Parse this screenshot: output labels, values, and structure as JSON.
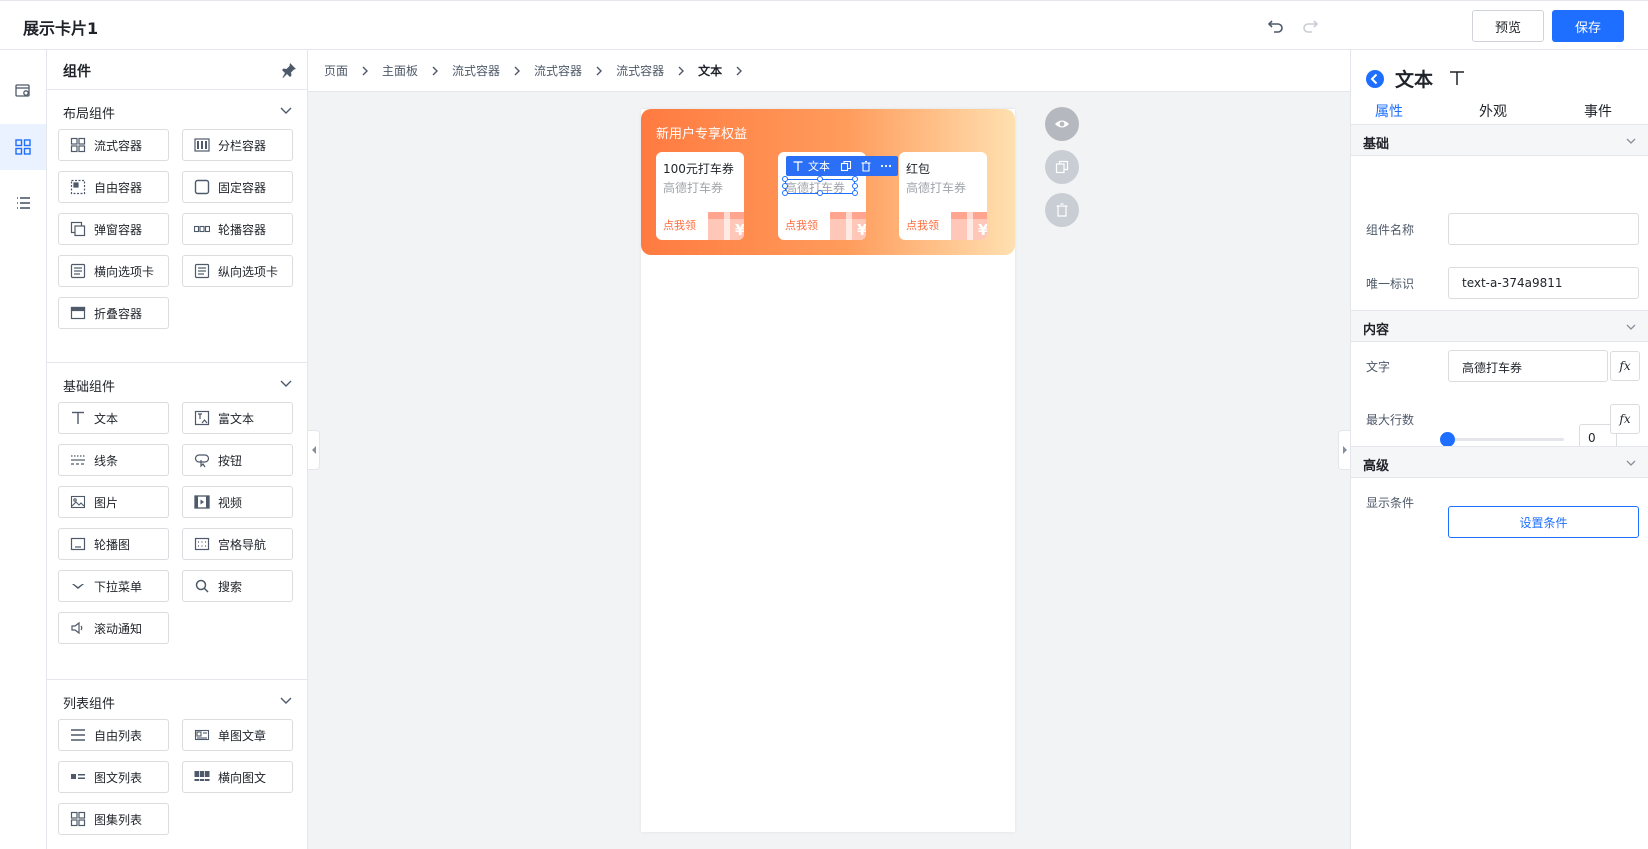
{
  "topbar": {
    "title": "展示卡片1",
    "undo_icon": "undo-icon",
    "redo_icon": "redo-icon",
    "preview_label": "预览",
    "save_label": "保存"
  },
  "rail": {
    "items": [
      {
        "icon": "page-settings-icon"
      },
      {
        "icon": "components-grid-icon",
        "active": true
      },
      {
        "icon": "outline-tree-icon"
      }
    ]
  },
  "panel": {
    "title": "组件",
    "groups": [
      {
        "title": "布局组件",
        "items": [
          {
            "label": "流式容器",
            "icon": "flow-container-icon"
          },
          {
            "label": "分栏容器",
            "icon": "columns-container-icon"
          },
          {
            "label": "自由容器",
            "icon": "free-container-icon"
          },
          {
            "label": "固定容器",
            "icon": "fixed-container-icon"
          },
          {
            "label": "弹窗容器",
            "icon": "popup-container-icon"
          },
          {
            "label": "轮播容器",
            "icon": "carousel-container-icon"
          },
          {
            "label": "横向选项卡",
            "icon": "horizontal-tabs-icon"
          },
          {
            "label": "纵向选项卡",
            "icon": "vertical-tabs-icon"
          },
          {
            "label": "折叠容器",
            "icon": "collapse-container-icon"
          }
        ]
      },
      {
        "title": "基础组件",
        "items": [
          {
            "label": "文本",
            "icon": "text-icon"
          },
          {
            "label": "富文本",
            "icon": "rich-text-icon"
          },
          {
            "label": "线条",
            "icon": "line-icon"
          },
          {
            "label": "按钮",
            "icon": "button-icon"
          },
          {
            "label": "图片",
            "icon": "image-icon"
          },
          {
            "label": "视频",
            "icon": "video-icon"
          },
          {
            "label": "轮播图",
            "icon": "carousel-icon"
          },
          {
            "label": "宫格导航",
            "icon": "grid-nav-icon"
          },
          {
            "label": "下拉菜单",
            "icon": "dropdown-icon"
          },
          {
            "label": "搜索",
            "icon": "search-icon"
          },
          {
            "label": "滚动通知",
            "icon": "notice-icon"
          }
        ]
      },
      {
        "title": "列表组件",
        "items": [
          {
            "label": "自由列表",
            "icon": "free-list-icon"
          },
          {
            "label": "单图文章",
            "icon": "single-image-article-icon"
          },
          {
            "label": "图文列表",
            "icon": "image-text-list-icon"
          },
          {
            "label": "横向图文",
            "icon": "horizontal-image-text-icon"
          },
          {
            "label": "图集列表",
            "icon": "gallery-list-icon"
          }
        ]
      }
    ]
  },
  "breadcrumb": [
    "页面",
    "主面板",
    "流式容器",
    "流式容器",
    "流式容器",
    "文本"
  ],
  "canvas": {
    "banner_title": "新用户专享权益",
    "coupons": [
      {
        "title": "100元打车券",
        "subtitle": "高德打车券",
        "action": "点我领"
      },
      {
        "title": "",
        "subtitle": "高德打车券",
        "action": "点我领"
      },
      {
        "title": "红包",
        "subtitle": "高德打车券",
        "action": "点我领"
      }
    ],
    "selection_toolbar_label": "文本",
    "colors": {
      "banner_start": "#ff7a40",
      "banner_end": "#ffe0b0",
      "coupon_action": "#ff6b3d",
      "selection": "#1e6fff"
    }
  },
  "props": {
    "title": "文本",
    "tabs": [
      "属性",
      "外观",
      "事件"
    ],
    "sections": {
      "basic": "基础",
      "content": "内容",
      "advanced": "高级"
    },
    "fields": {
      "name_label": "组件名称",
      "name_value": "",
      "id_label": "唯一标识",
      "id_value": "text-a-374a9811",
      "text_label": "文字",
      "text_value": "高德打车券",
      "max_lines_label": "最大行数",
      "max_lines_value": "0",
      "fx": "fx",
      "condition_label": "显示条件",
      "condition_button": "设置条件"
    },
    "colors": {
      "accent": "#1e6fff"
    }
  }
}
